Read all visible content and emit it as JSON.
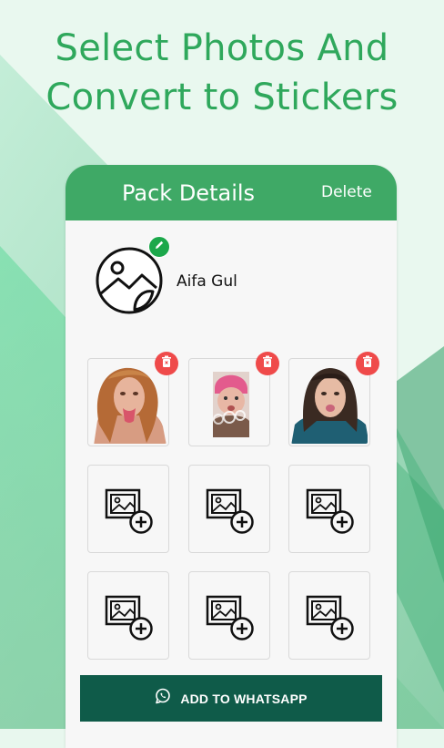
{
  "headline": {
    "line1": "Select Photos And",
    "line2": "Convert to Stickers"
  },
  "colors": {
    "brand_green": "#3fa966",
    "headline_green": "#2fa85c",
    "cta_dark": "#0f5b49",
    "delete_red": "#ef4a4a",
    "edit_green": "#1ca84b"
  },
  "appbar": {
    "title": "Pack Details",
    "delete_label": "Delete"
  },
  "pack": {
    "name": "Aifa Gul",
    "icon": "image-placeholder-icon"
  },
  "stickers": [
    {
      "name": "sticker-1",
      "subject": "woman-tongue-out",
      "has_delete": true
    },
    {
      "name": "sticker-2",
      "subject": "child-pink-hat",
      "has_delete": true
    },
    {
      "name": "sticker-3",
      "subject": "girl-tongue-out",
      "has_delete": true
    }
  ],
  "empty_slots": 6,
  "cta": {
    "label": "ADD TO WHATSAPP",
    "icon": "whatsapp-icon"
  }
}
